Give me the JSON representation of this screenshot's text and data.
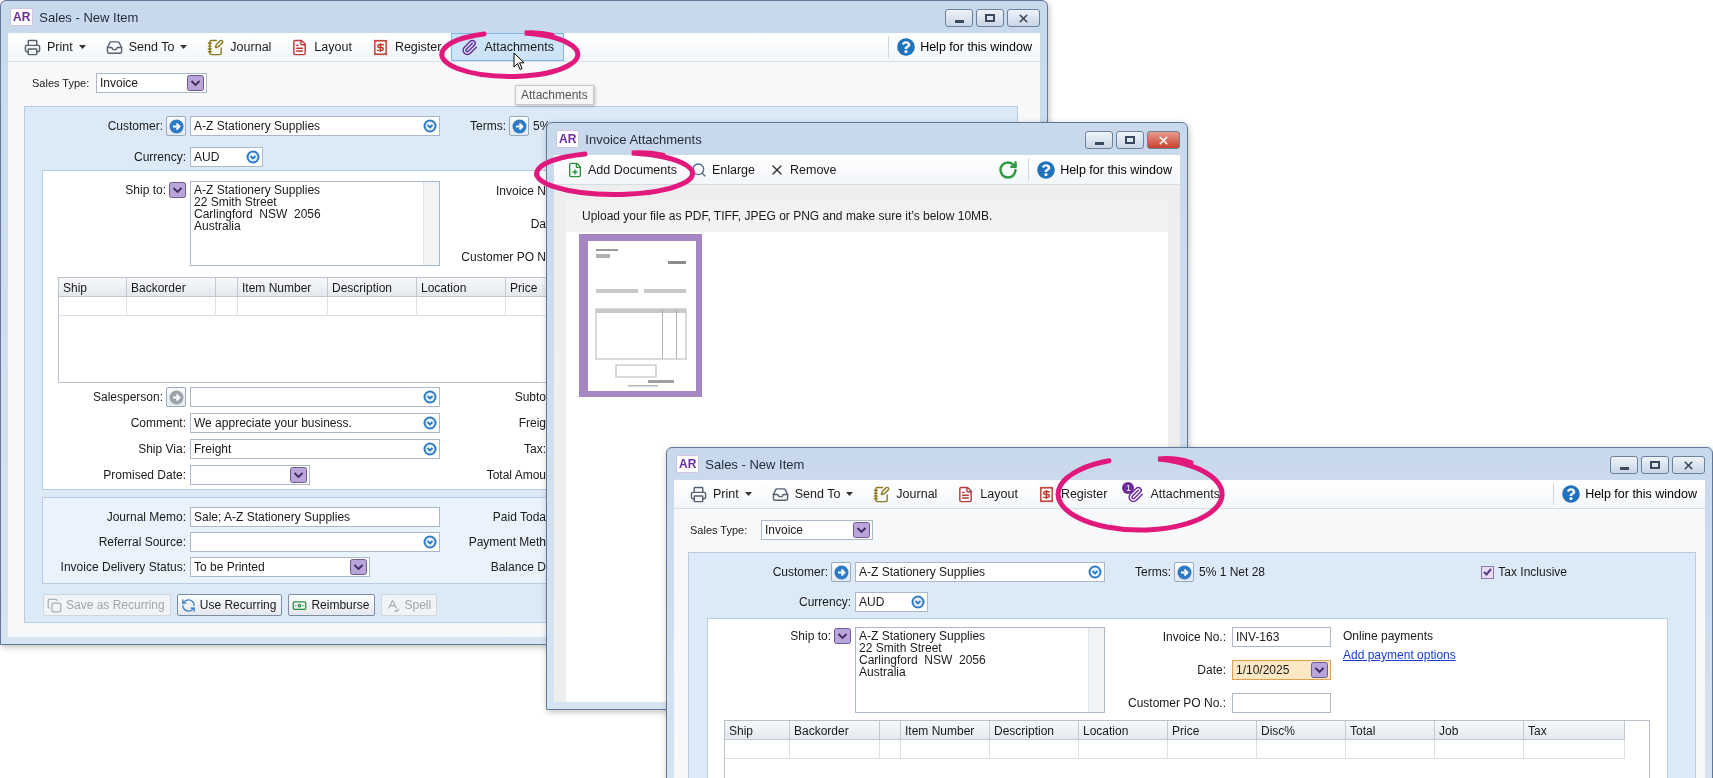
{
  "sales_window_back": {
    "badge": "AR",
    "title": "Sales - New Item",
    "toolbar": [
      {
        "kind": "print",
        "label": "Print",
        "dropdown": true,
        "selected": false
      },
      {
        "kind": "send",
        "label": "Send To",
        "dropdown": true,
        "selected": false
      },
      {
        "kind": "journal",
        "label": "Journal",
        "dropdown": false,
        "selected": false
      },
      {
        "kind": "layout",
        "label": "Layout",
        "dropdown": false,
        "selected": false
      },
      {
        "kind": "register",
        "label": "Register",
        "dropdown": false,
        "selected": false
      },
      {
        "kind": "attachments",
        "label": "Attachments",
        "dropdown": false,
        "selected": true
      }
    ],
    "help": "Help for this window",
    "tooltip": "Attachments",
    "sales_type": {
      "label": "Sales Type:",
      "value": "Invoice"
    },
    "customer": {
      "label": "Customer:",
      "value": "A-Z Stationery Supplies"
    },
    "terms": {
      "label": "Terms:",
      "value": "5%"
    },
    "currency": {
      "label": "Currency:",
      "value": "AUD"
    },
    "ship_to": {
      "label": "Ship to:",
      "lines": [
        "A-Z Stationery Supplies",
        "22 Smith Street",
        "Carlingford  NSW  2056",
        "Australia"
      ]
    },
    "invoice_labels": [
      "Invoice N",
      "Da",
      "Customer PO N"
    ],
    "columns": [
      "Ship",
      "Backorder",
      "Item Number",
      "Description",
      "Location",
      "Price"
    ],
    "details": [
      {
        "label": "Salesperson:",
        "kind": "combo",
        "lookup_enabled": false
      },
      {
        "label": "Comment:",
        "kind": "combo",
        "value": "We appreciate your business."
      },
      {
        "label": "Ship Via:",
        "kind": "combo",
        "value": "Freight"
      },
      {
        "label": "Promised Date:",
        "kind": "select"
      }
    ],
    "totals_labels": [
      "Subto",
      "Freig",
      "Tax:",
      "Total Amou"
    ],
    "memo_fields": [
      {
        "label": "Journal Memo:",
        "kind": "text",
        "value": "Sale; A-Z Stationery Supplies"
      },
      {
        "label": "Referral Source:",
        "kind": "combo"
      },
      {
        "label": "Invoice Delivery Status:",
        "kind": "select",
        "value": "To be Printed"
      }
    ],
    "payment_labels": [
      "Paid Toda",
      "Payment Meth",
      "Balance D"
    ],
    "buttons": [
      {
        "kind": "save_recurring",
        "label": "Save as Recurring",
        "disabled": true
      },
      {
        "kind": "use_recurring",
        "label": "Use Recurring",
        "disabled": false
      },
      {
        "kind": "reimburse",
        "label": "Reimburse",
        "disabled": false
      },
      {
        "kind": "spell",
        "label": "Spell",
        "disabled": true
      }
    ]
  },
  "attachments_window": {
    "badge": "AR",
    "title": "Invoice Attachments",
    "active": true,
    "toolbar": [
      {
        "kind": "add",
        "label": "Add Documents"
      },
      {
        "kind": "enlarge",
        "label": "Enlarge"
      },
      {
        "kind": "remove",
        "label": "Remove"
      }
    ],
    "help": "Help for this window",
    "note": "Upload your file as PDF, TIFF, JPEG or PNG and make sure it’s below 10MB.",
    "files": [
      {
        "selected": true
      }
    ]
  },
  "sales_window_front": {
    "badge": "AR",
    "title": "Sales - New Item",
    "toolbar": [
      {
        "kind": "print",
        "label": "Print",
        "dropdown": true,
        "selected": false
      },
      {
        "kind": "send",
        "label": "Send To",
        "dropdown": true,
        "selected": false
      },
      {
        "kind": "journal",
        "label": "Journal",
        "dropdown": false,
        "selected": false
      },
      {
        "kind": "layout",
        "label": "Layout",
        "dropdown": false,
        "selected": false
      },
      {
        "kind": "register",
        "label": "Register",
        "dropdown": false,
        "selected": false
      },
      {
        "kind": "attachments",
        "label": "Attachments",
        "dropdown": false,
        "selected": false,
        "badge": "1"
      }
    ],
    "help": "Help for this window",
    "sales_type": {
      "label": "Sales Type:",
      "value": "Invoice"
    },
    "customer": {
      "label": "Customer:",
      "value": "A-Z Stationery Supplies"
    },
    "terms": {
      "label": "Terms:",
      "value": "5% 1 Net 28"
    },
    "tax_inclusive": {
      "label": "Tax Inclusive",
      "checked": true
    },
    "currency": {
      "label": "Currency:",
      "value": "AUD"
    },
    "ship_to": {
      "label": "Ship to:",
      "lines": [
        "A-Z Stationery Supplies",
        "22 Smith Street",
        "Carlingford  NSW  2056",
        "Australia"
      ]
    },
    "invoice_fields": [
      {
        "label": "Invoice No.:",
        "kind": "text",
        "value": "INV-163",
        "focused": false
      },
      {
        "label": "Date:",
        "kind": "select",
        "value": "1/10/2025",
        "focused": true
      },
      {
        "label": "Customer PO No.:",
        "kind": "text",
        "focused": false
      }
    ],
    "online_payments": {
      "title": "Online payments",
      "link": "Add payment options"
    },
    "columns": [
      "Ship",
      "Backorder",
      "Item Number",
      "Description",
      "Location",
      "Price",
      "Disc%",
      "Total",
      "Job",
      "Tax"
    ]
  }
}
